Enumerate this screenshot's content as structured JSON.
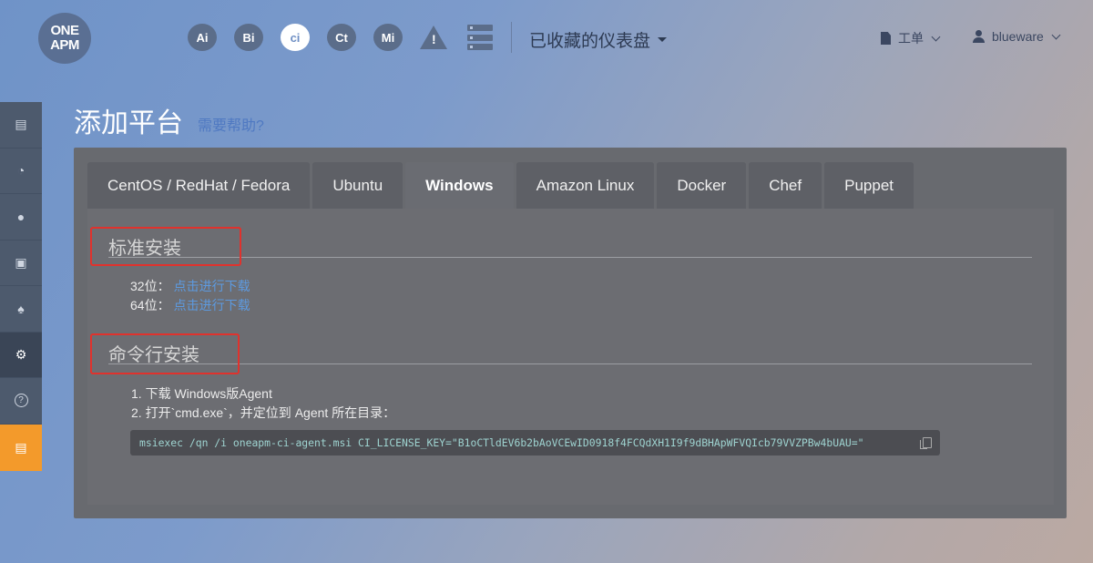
{
  "logo": {
    "line1": "ONE",
    "line2": "APM"
  },
  "products": [
    {
      "label": "Ai",
      "icon": "ai-icon"
    },
    {
      "label": "Bi",
      "icon": "bi-icon"
    },
    {
      "label": "ci",
      "icon": "ci-icon",
      "active": true
    },
    {
      "label": "Ct",
      "icon": "ct-icon"
    },
    {
      "label": "Mi",
      "icon": "mi-icon"
    }
  ],
  "alert_glyph": "!",
  "dashboard_menu": "已收藏的仪表盘",
  "tickets_label": "工单",
  "user_name": "blueware",
  "sidebar": {
    "items": [
      {
        "icon": "server-list-icon",
        "glyph": "▤"
      },
      {
        "icon": "dashboard-gauge-icon",
        "glyph": "◔"
      },
      {
        "icon": "circle-dot-icon",
        "glyph": "●"
      },
      {
        "icon": "archive-box-icon",
        "glyph": "▣"
      },
      {
        "icon": "bell-icon",
        "glyph": "♠"
      },
      {
        "icon": "gear-icon",
        "glyph": "⚙",
        "active": true
      },
      {
        "icon": "help-circle-icon",
        "glyph": "?"
      },
      {
        "icon": "card-icon",
        "glyph": "▤",
        "orange": true
      }
    ]
  },
  "page": {
    "title": "添加平台",
    "help": "需要帮助?"
  },
  "tabs": [
    "CentOS / RedHat / Fedora",
    "Ubuntu",
    "Windows",
    "Amazon Linux",
    "Docker",
    "Chef",
    "Puppet"
  ],
  "active_tab": "Windows",
  "standard_install": {
    "title": "标准安装",
    "rows": [
      {
        "label": "32位：",
        "link": "点击进行下载"
      },
      {
        "label": "64位：",
        "link": "点击进行下载"
      }
    ]
  },
  "cli_install": {
    "title": "命令行安装",
    "step1": "1. 下载 Windows版Agent",
    "step2": "2. 打开`cmd.exe`，并定位到 Agent 所在目录：",
    "command": "msiexec /qn /i oneapm-ci-agent.msi CI_LICENSE_KEY=\"B1oCTldEV6b2bAoVCEwID0918f4FCQdXH1I9f9dBHApWFVQIcb79VVZPBw4bUAU=\""
  },
  "colors": {
    "accent_orange": "#f39a2b",
    "link_blue": "#5d9ae0",
    "highlight_red": "#e0322d"
  }
}
